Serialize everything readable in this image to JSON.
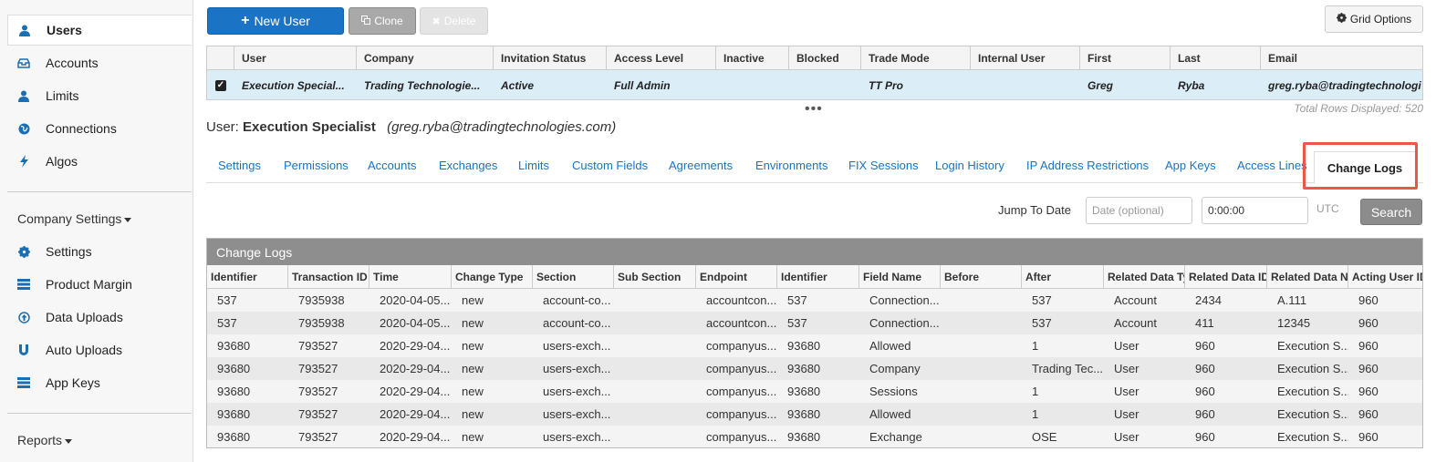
{
  "sidebar": {
    "items": [
      {
        "label": "Users",
        "icon": "user-icon"
      },
      {
        "label": "Accounts",
        "icon": "inbox-icon"
      },
      {
        "label": "Limits",
        "icon": "user-icon"
      },
      {
        "label": "Connections",
        "icon": "globe-icon"
      },
      {
        "label": "Algos",
        "icon": "bolt-icon"
      }
    ],
    "company_settings_label": "Company Settings",
    "company_items": [
      {
        "label": "Settings",
        "icon": "gear-icon"
      },
      {
        "label": "Product Margin",
        "icon": "list-icon"
      },
      {
        "label": "Data Uploads",
        "icon": "upload-icon"
      },
      {
        "label": "Auto Uploads",
        "icon": "magnet-icon"
      },
      {
        "label": "App Keys",
        "icon": "list-icon"
      }
    ],
    "reports_label": "Reports"
  },
  "toolbar": {
    "new_user": "New User",
    "clone": "Clone",
    "delete": "Delete",
    "grid_options": "Grid Options"
  },
  "users_grid": {
    "columns": [
      "User",
      "Company",
      "Invitation Status",
      "Access Level",
      "Inactive",
      "Blocked",
      "Trade Mode",
      "Internal User",
      "First",
      "Last",
      "Email"
    ],
    "row": [
      "Execution Special...",
      "Trading Technologie...",
      "Active",
      "Full Admin",
      "",
      "",
      "TT Pro",
      "",
      "Greg",
      "Ryba",
      "greg.ryba@tradingtechnologi"
    ],
    "total_rows": "Total Rows Displayed: 520"
  },
  "user_header": {
    "prefix": "User:",
    "name": "Execution Specialist",
    "email": "(greg.ryba@tradingtechnologies.com)"
  },
  "tabs": [
    "Settings",
    "Permissions",
    "Accounts",
    "Exchanges",
    "Limits",
    "Custom Fields",
    "Agreements",
    "Environments",
    "FIX Sessions",
    "Login History",
    "IP Address Restrictions",
    "App Keys",
    "Access Lines"
  ],
  "active_tab": "Change Logs",
  "jump": {
    "label": "Jump To Date",
    "date_placeholder": "Date (optional)",
    "time_value": "0:00:00",
    "utc": "UTC",
    "search": "Search"
  },
  "change_logs": {
    "title": "Change Logs",
    "columns": [
      "Identifier",
      "Transaction ID",
      "Time",
      "Change Type",
      "Section",
      "Sub Section",
      "Endpoint",
      "Identifier",
      "Field Name",
      "Before",
      "After",
      "Related Data Type",
      "Related Data ID",
      "Related Data Name",
      "Acting User ID"
    ],
    "rows": [
      [
        "537",
        "7935938",
        "2020-04-05...",
        "new",
        "account-co...",
        "",
        "accountcon...",
        "537",
        "Connection...",
        "",
        "537",
        "Account",
        "2434",
        "A.111",
        "960"
      ],
      [
        "537",
        "7935938",
        "2020-04-05...",
        "new",
        "account-co...",
        "",
        "accountcon...",
        "537",
        "Connection...",
        "",
        "537",
        "Account",
        "411",
        "12345",
        "960"
      ],
      [
        "93680",
        "793527",
        "2020-29-04...",
        "new",
        "users-exch...",
        "",
        "companyus...",
        "93680",
        "Allowed",
        "",
        "1",
        "User",
        "960",
        "Execution S...",
        "960"
      ],
      [
        "93680",
        "793527",
        "2020-29-04...",
        "new",
        "users-exch...",
        "",
        "companyus...",
        "93680",
        "Company",
        "",
        "Trading Tec...",
        "User",
        "960",
        "Execution S...",
        "960"
      ],
      [
        "93680",
        "793527",
        "2020-29-04...",
        "new",
        "users-exch...",
        "",
        "companyus...",
        "93680",
        "Sessions",
        "",
        "1",
        "User",
        "960",
        "Execution S...",
        "960"
      ],
      [
        "93680",
        "793527",
        "2020-29-04...",
        "new",
        "users-exch...",
        "",
        "companyus...",
        "93680",
        "Allowed",
        "",
        "1",
        "User",
        "960",
        "Execution S...",
        "960"
      ],
      [
        "93680",
        "793527",
        "2020-29-04...",
        "new",
        "users-exch...",
        "",
        "companyus...",
        "93680",
        "Exchange",
        "",
        "OSE",
        "User",
        "960",
        "Execution S...",
        "960"
      ]
    ]
  },
  "colors": {
    "primary": "#1a73c4",
    "highlight": "#e8584d",
    "selected_row": "#dbeef7",
    "panel_header": "#8e8e8e"
  }
}
